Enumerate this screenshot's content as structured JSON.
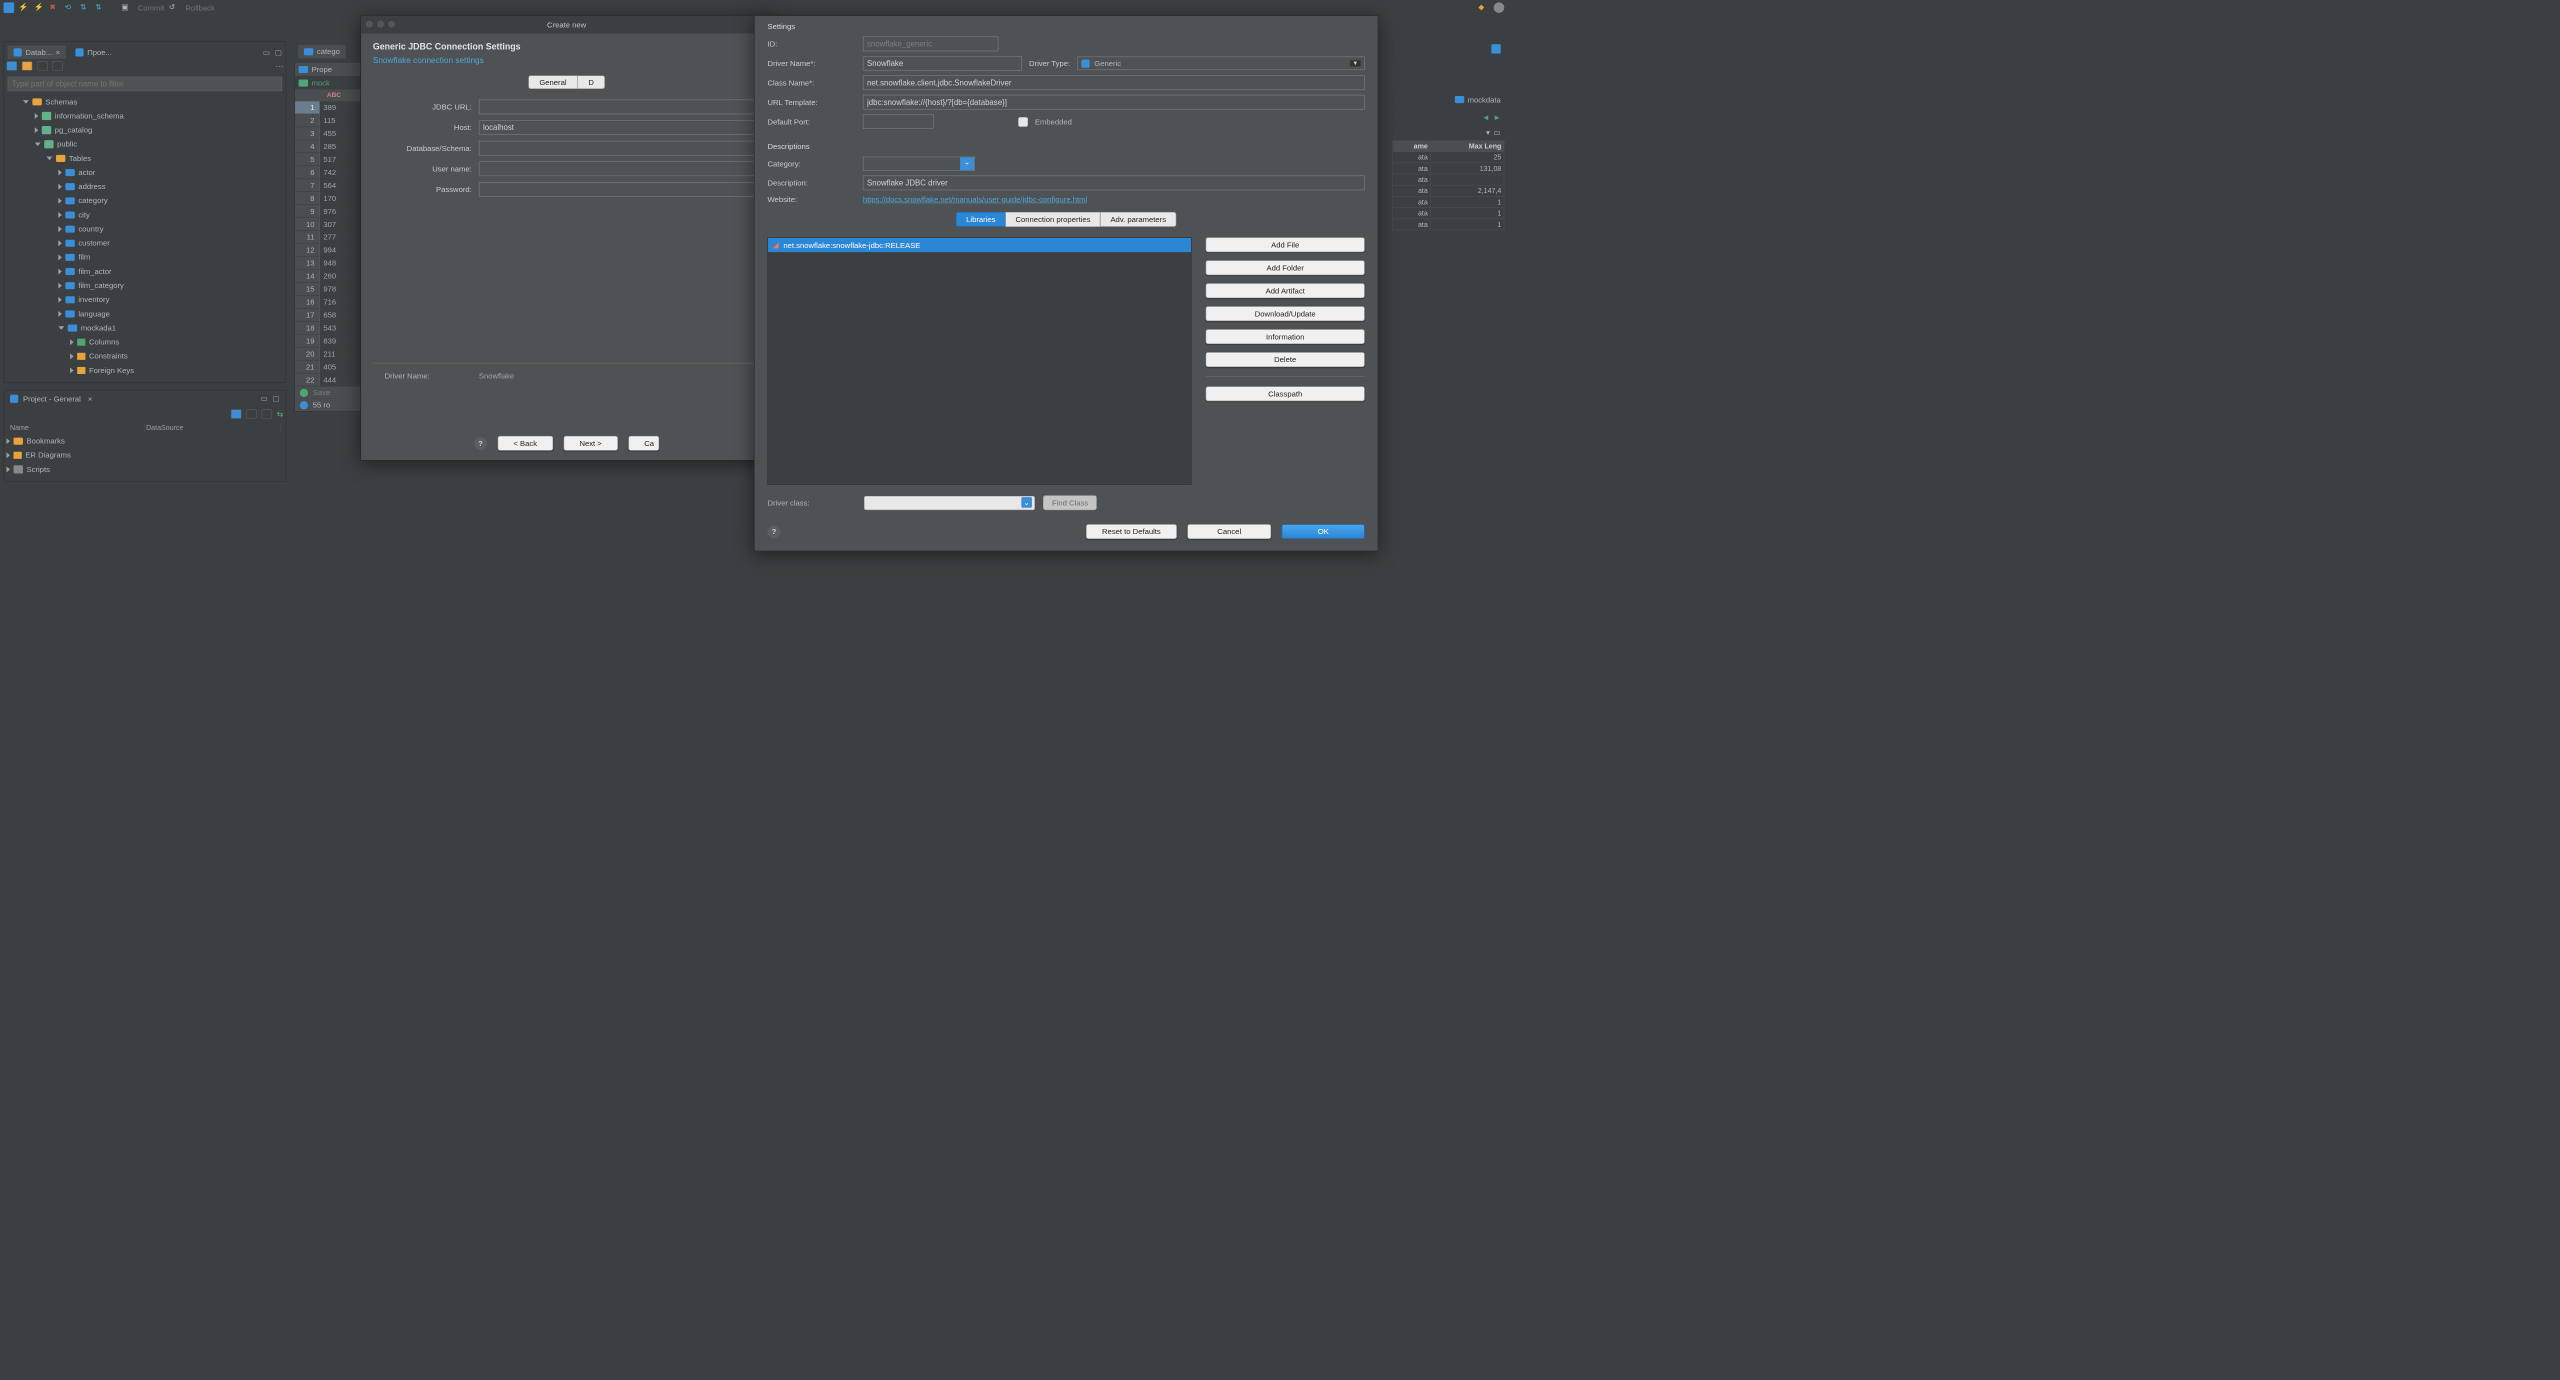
{
  "toolbar": {
    "commit": "Commit",
    "rollback": "Rollback"
  },
  "db_panel": {
    "tab1": "Datab...",
    "tab2": "Прое...",
    "filter_placeholder": "Type part of object name to filter",
    "tree": {
      "schemas": "Schemas",
      "info": "information_schema",
      "pgcat": "pg_catalog",
      "public": "public",
      "tables": "Tables",
      "items": [
        "actor",
        "address",
        "category",
        "city",
        "country",
        "customer",
        "film",
        "film_actor",
        "film_category",
        "inventory",
        "language",
        "mockada1"
      ],
      "mock_children": {
        "columns": "Columns",
        "constraints": "Constraints",
        "fkeys": "Foreign Keys"
      }
    }
  },
  "project_panel": {
    "title": "Project - General",
    "cols": [
      "Name",
      "DataSource"
    ],
    "items": [
      "Bookmarks",
      "ER Diagrams",
      "Scripts"
    ]
  },
  "grid": {
    "tab1": "catego",
    "tab2": "Prope",
    "tab3": "mock",
    "rows": [
      "389",
      "115",
      "455",
      "285",
      "517",
      "742",
      "564",
      "170",
      "976",
      "307",
      "277",
      "994",
      "948",
      "260",
      "978",
      "716",
      "658",
      "543",
      "839",
      "211",
      "405",
      "444"
    ],
    "save": "Save",
    "status": "55 ro"
  },
  "right": {
    "tab": "mockdata",
    "hdr1": "ame",
    "hdr2": "Max Leng",
    "vals": [
      "25",
      "131,08",
      "",
      "2,147,4",
      "1",
      "1",
      "1"
    ],
    "col1": "ata"
  },
  "dialog1": {
    "window_title": "Create new",
    "title": "Generic JDBC Connection Settings",
    "link": "Snowflake connection settings",
    "tabs": [
      "General",
      "D"
    ],
    "labels": {
      "url": "JDBC URL:",
      "host": "Host:",
      "db": "Database/Schema:",
      "user": "User name:",
      "pass": "Password:"
    },
    "host_value": "localhost",
    "driver_label": "Driver Name:",
    "driver_value": "Snowflake",
    "back": "< Back",
    "next": "Next >",
    "cancel": "Ca"
  },
  "dialog2": {
    "settings": "Settings",
    "id_label": "ID:",
    "id_value": "snowflake_generic",
    "dname_label": "Driver Name*:",
    "dname_value": "Snowflake",
    "dtype_label": "Driver Type:",
    "dtype_value": "Generic",
    "class_label": "Class Name*:",
    "class_value": "net.snowflake.client.jdbc.SnowflakeDriver",
    "url_label": "URL Template:",
    "url_value": "jdbc:snowflake://{host}/?[db={database}]",
    "port_label": "Default Port:",
    "embed": "Embedded",
    "descs": "Descriptions",
    "cat_label": "Category:",
    "desc_label": "Description:",
    "desc_value": "Snowflake JDBC driver",
    "web_label": "Website:",
    "web_url": "https://docs.snowflake.net/manuals/user-guide/jdbc-configure.html",
    "tabs": [
      "Libraries",
      "Connection properties",
      "Adv. parameters"
    ],
    "lib_item": "net.snowflake:snowflake-jdbc:RELEASE",
    "buttons": [
      "Add File",
      "Add Folder",
      "Add Artifact",
      "Download/Update",
      "Information",
      "Delete"
    ],
    "classpath": "Classpath",
    "dclass_label": "Driver class:",
    "find": "Find Class",
    "reset": "Reset to Defaults",
    "cancel": "Cancel",
    "ok": "OK"
  }
}
